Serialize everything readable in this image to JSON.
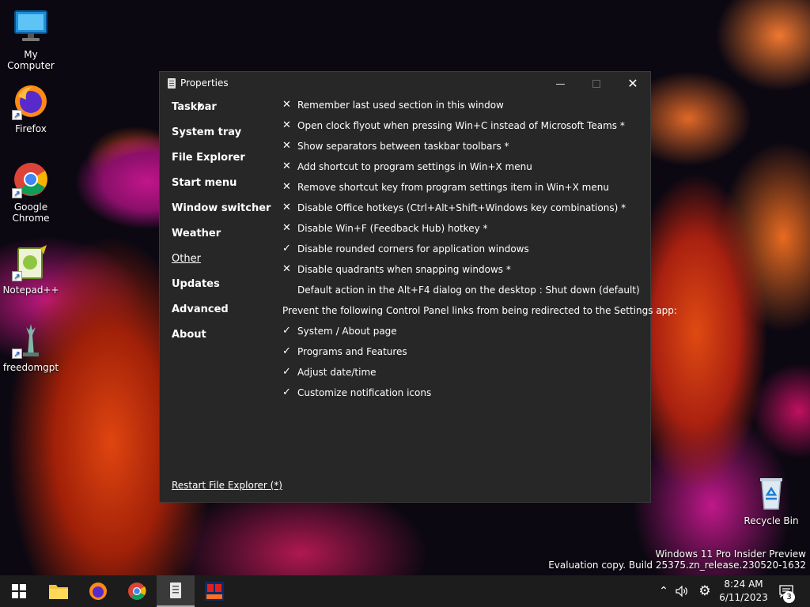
{
  "desktop": {
    "icons": [
      {
        "label": "My Computer"
      },
      {
        "label": "Firefox"
      },
      {
        "label": "Google Chrome"
      },
      {
        "label": "Notepad++"
      },
      {
        "label": "freedomgpt"
      },
      {
        "label": "Recycle Bin"
      }
    ],
    "watermark": {
      "line1": "Windows 11 Pro Insider Preview",
      "line2": "Evaluation copy. Build 25375.zn_release.230520-1632"
    }
  },
  "window": {
    "title": "Properties",
    "nav": [
      {
        "label": "Taskbar",
        "active": false
      },
      {
        "label": "System tray",
        "active": false
      },
      {
        "label": "File Explorer",
        "active": false
      },
      {
        "label": "Start menu",
        "active": false
      },
      {
        "label": "Window switcher",
        "active": false
      },
      {
        "label": "Weather",
        "active": false
      },
      {
        "label": "Other",
        "active": true
      },
      {
        "label": "Updates",
        "active": false
      },
      {
        "label": "Advanced",
        "active": false
      },
      {
        "label": "About",
        "active": false
      }
    ],
    "options": [
      {
        "mark": "✕",
        "label": "Remember last used section in this window"
      },
      {
        "mark": "✕",
        "label": "Open clock flyout when pressing Win+C instead of Microsoft Teams *"
      },
      {
        "mark": "✕",
        "label": "Show separators between taskbar toolbars *"
      },
      {
        "mark": "✕",
        "label": "Add shortcut to program settings in Win+X menu"
      },
      {
        "mark": "✕",
        "label": "Remove shortcut key from program settings item in Win+X menu"
      },
      {
        "mark": "✕",
        "label": "Disable Office hotkeys (Ctrl+Alt+Shift+Windows key combinations) *"
      },
      {
        "mark": "✕",
        "label": "Disable Win+F (Feedback Hub) hotkey *"
      },
      {
        "mark": "✓",
        "label": "Disable rounded corners for application windows"
      },
      {
        "mark": "✕",
        "label": "Disable quadrants when snapping windows *"
      },
      {
        "mark": "",
        "label": "Default action in the Alt+F4 dialog on the desktop : Shut down (default)"
      }
    ],
    "redirect_heading": "Prevent the following Control Panel links from being redirected to the Settings app:",
    "redirect_options": [
      {
        "mark": "✓",
        "label": "System / About page"
      },
      {
        "mark": "✓",
        "label": "Programs and Features"
      },
      {
        "mark": "✓",
        "label": "Adjust date/time"
      },
      {
        "mark": "✓",
        "label": "Customize notification icons"
      }
    ],
    "restart_link": "Restart File Explorer (*)"
  },
  "taskbar": {
    "time": "8:24 AM",
    "date": "6/11/2023",
    "notification_count": "3"
  }
}
